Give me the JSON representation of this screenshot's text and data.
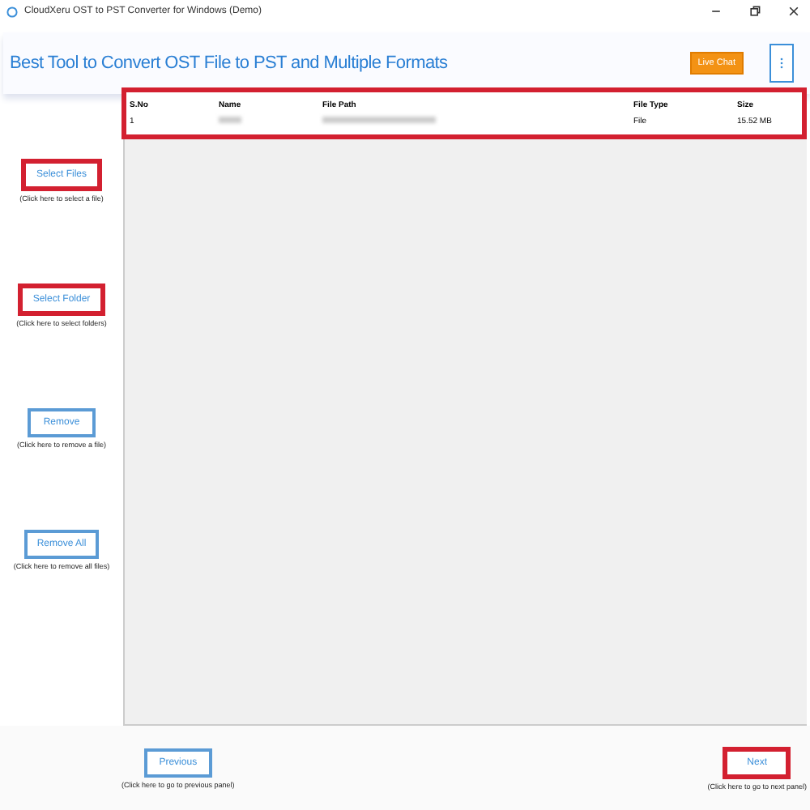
{
  "window": {
    "title": "CloudXeru OST to PST Converter for Windows (Demo)"
  },
  "header": {
    "title": "Best Tool to Convert OST File to PST and Multiple Formats",
    "live_chat": "Live Chat"
  },
  "side_buttons": [
    {
      "label": "Select Files",
      "hint": "(Click here to select a file)",
      "highlighted": true
    },
    {
      "label": "Select Folder",
      "hint": "(Click here to select folders)",
      "highlighted": true
    },
    {
      "label": "Remove",
      "hint": "(Click here to remove a file)",
      "highlighted": false
    },
    {
      "label": "Remove All",
      "hint": "(Click here to remove all files)",
      "highlighted": false
    }
  ],
  "table": {
    "highlighted": true,
    "columns": [
      "S.No",
      "Name",
      "File Path",
      "File Type",
      "Size"
    ],
    "rows": [
      {
        "sno": "1",
        "file_type": "File",
        "size": "15.52 MB"
      }
    ]
  },
  "footer": {
    "previous": {
      "label": "Previous",
      "hint": "(Click here to go to previous panel)",
      "highlighted": false
    },
    "next": {
      "label": "Next",
      "hint": "(Click here to go to next panel)",
      "highlighted": true
    }
  }
}
